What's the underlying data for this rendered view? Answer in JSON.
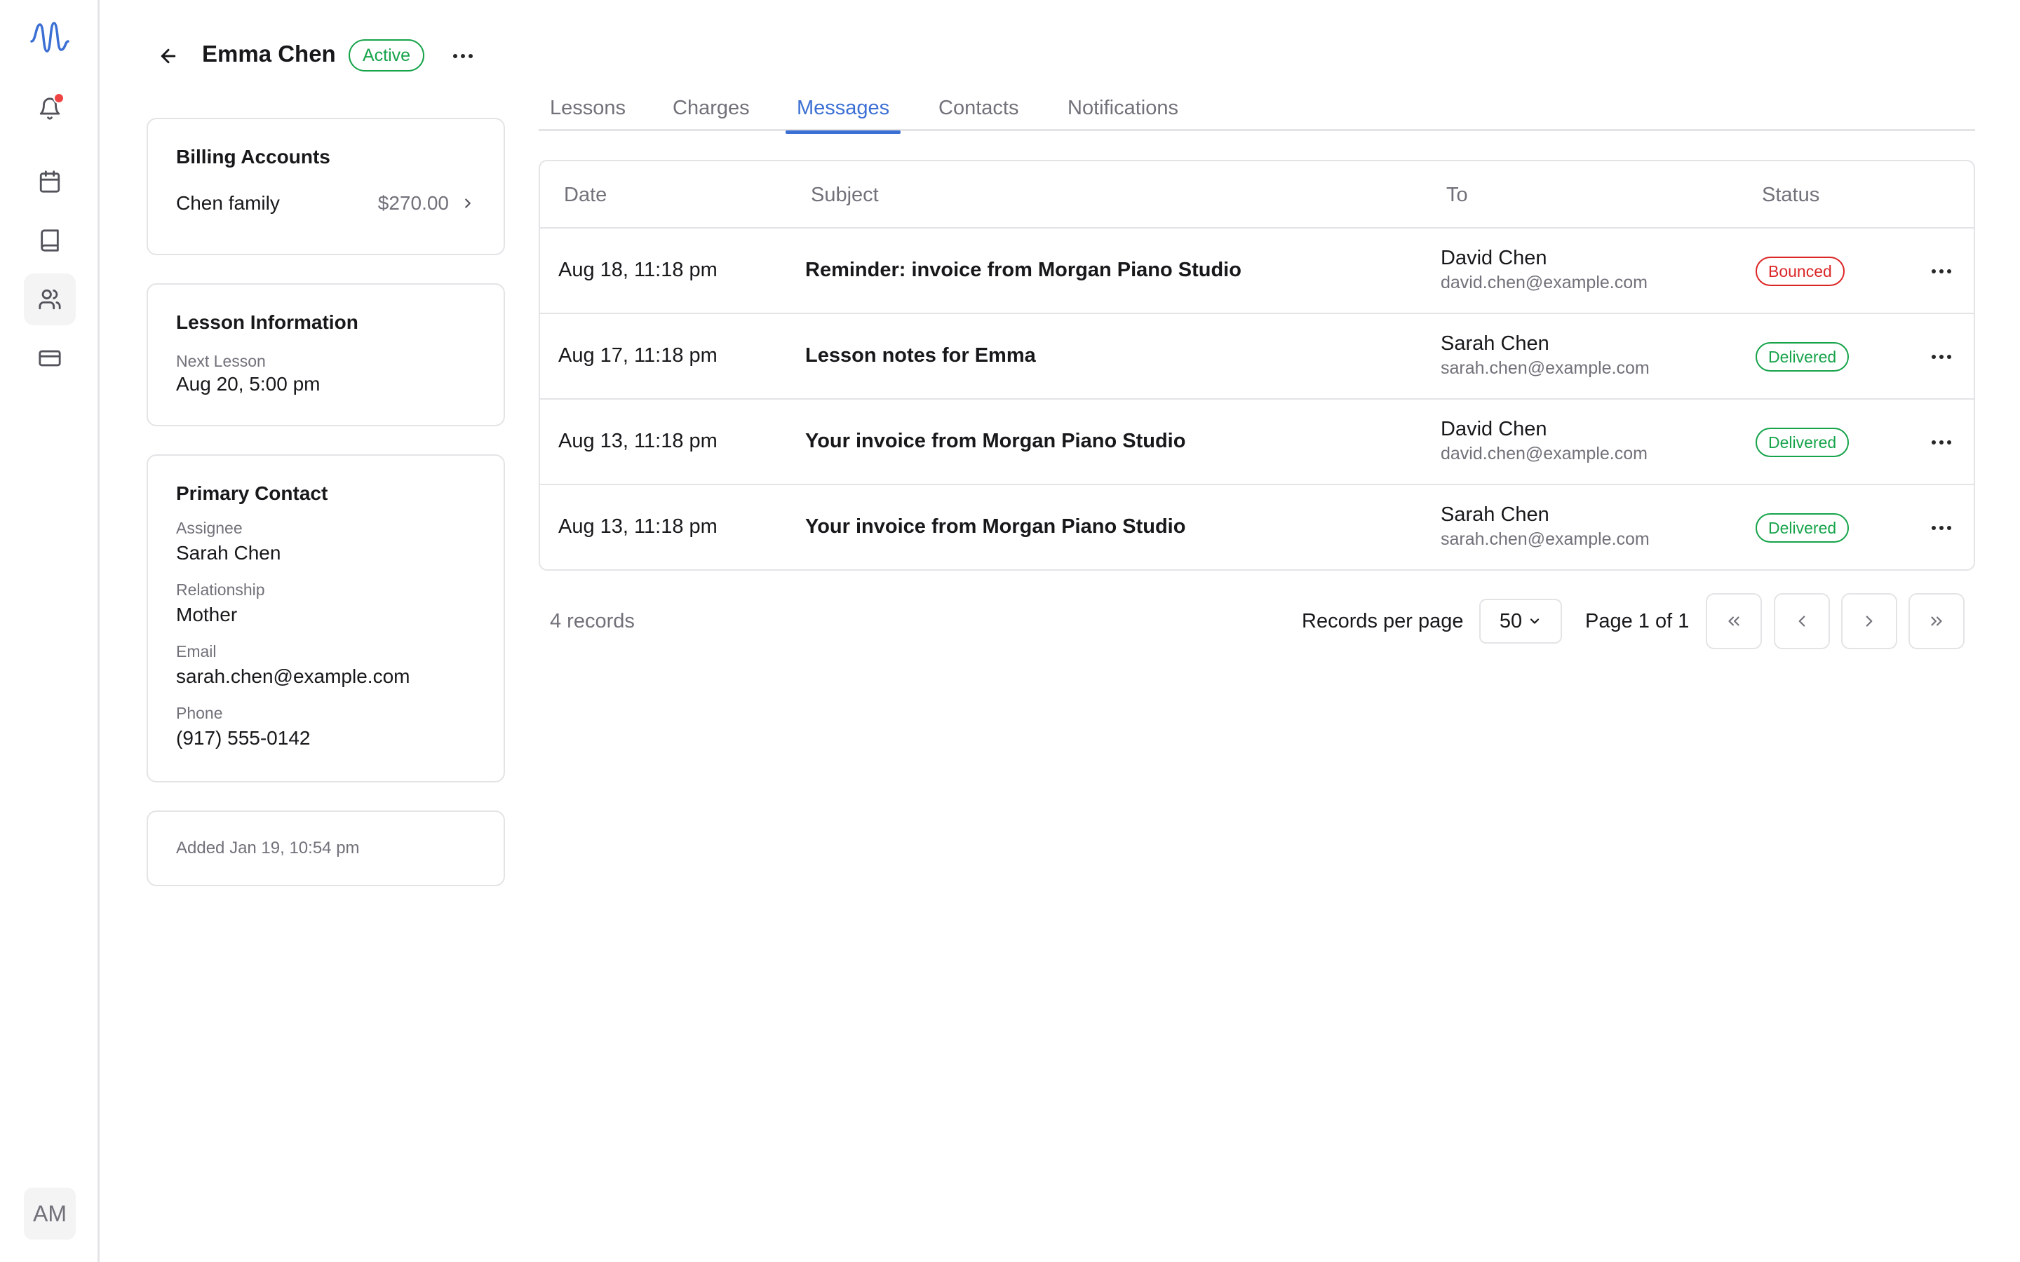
{
  "header": {
    "title": "Emma Chen",
    "status": "Active"
  },
  "sidebar": {
    "avatar_initials": "AM",
    "items": [
      {
        "icon": "bell-icon",
        "has_notification": true
      },
      {
        "icon": "calendar-icon"
      },
      {
        "icon": "book-icon"
      },
      {
        "icon": "users-icon",
        "active": true
      },
      {
        "icon": "credit-card-icon"
      }
    ]
  },
  "billing": {
    "title": "Billing Accounts",
    "account_name": "Chen family",
    "amount": "$270.00"
  },
  "lesson": {
    "title": "Lesson Information",
    "next_label": "Next Lesson",
    "next_value": "Aug 20, 5:00 pm"
  },
  "contact": {
    "title": "Primary Contact",
    "assignee_label": "Assignee",
    "assignee_value": "Sarah Chen",
    "relationship_label": "Relationship",
    "relationship_value": "Mother",
    "email_label": "Email",
    "email_value": "sarah.chen@example.com",
    "phone_label": "Phone",
    "phone_value": "(917) 555-0142"
  },
  "added": {
    "text": "Added Jan 19, 10:54 pm"
  },
  "tabs": [
    {
      "label": "Lessons",
      "active": false
    },
    {
      "label": "Charges",
      "active": false
    },
    {
      "label": "Messages",
      "active": true
    },
    {
      "label": "Contacts",
      "active": false
    },
    {
      "label": "Notifications",
      "active": false
    }
  ],
  "table": {
    "columns": [
      "Date",
      "Subject",
      "To",
      "Status"
    ],
    "rows": [
      {
        "date": "Aug 18, 11:18 pm",
        "subject": "Reminder: invoice from Morgan Piano Studio",
        "to_name": "David Chen",
        "to_email": "david.chen@example.com",
        "status": "Bounced"
      },
      {
        "date": "Aug 17, 11:18 pm",
        "subject": "Lesson notes for Emma",
        "to_name": "Sarah Chen",
        "to_email": "sarah.chen@example.com",
        "status": "Delivered"
      },
      {
        "date": "Aug 13, 11:18 pm",
        "subject": "Your invoice from Morgan Piano Studio",
        "to_name": "David Chen",
        "to_email": "david.chen@example.com",
        "status": "Delivered"
      },
      {
        "date": "Aug 13, 11:18 pm",
        "subject": "Your invoice from Morgan Piano Studio",
        "to_name": "Sarah Chen",
        "to_email": "sarah.chen@example.com",
        "status": "Delivered"
      }
    ]
  },
  "pagination": {
    "records": "4 records",
    "per_page_label": "Records per page",
    "per_page_value": "50",
    "page_info": "Page 1 of 1"
  },
  "colors": {
    "accent": "#3b6fd4",
    "success": "#16a34a",
    "danger": "#dc2626",
    "notification": "#ef4444"
  }
}
